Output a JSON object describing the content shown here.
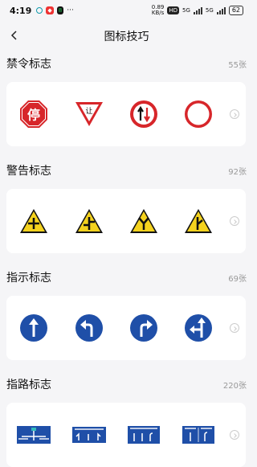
{
  "status": {
    "time": "4:19",
    "network_speed": "0.89\nKB/s",
    "hd_badge": "HD",
    "signal_1": "5G",
    "signal_2": "5G",
    "battery": "62",
    "app_icons": [
      "notification-icon",
      "red-app-icon",
      "green-app-icon"
    ]
  },
  "header": {
    "title": "图标技巧"
  },
  "sections": [
    {
      "title": "禁令标志",
      "count": "55张",
      "signs": [
        {
          "label": "停"
        },
        {
          "label": "让"
        },
        {
          "label": ""
        },
        {
          "label": ""
        }
      ]
    },
    {
      "title": "警告标志",
      "count": "92张"
    },
    {
      "title": "指示标志",
      "count": "69张"
    },
    {
      "title": "指路标志",
      "count": "220张"
    }
  ],
  "colors": {
    "red": "#d7262a",
    "yellow": "#f4d21e",
    "blue": "#1f4fa8",
    "bg": "#f5f5f7"
  }
}
